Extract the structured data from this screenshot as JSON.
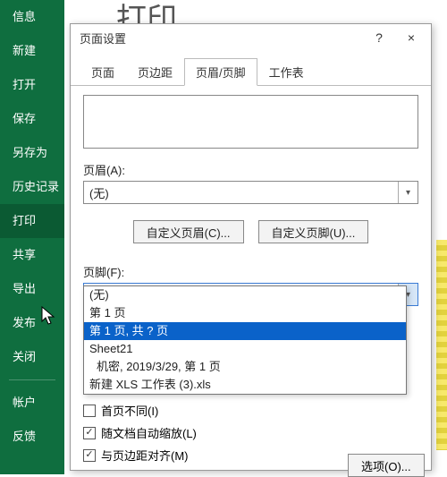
{
  "title": "打印",
  "sidebar": {
    "items": [
      "信息",
      "新建",
      "打开",
      "保存",
      "另存为",
      "历史记录",
      "打印",
      "共享",
      "导出",
      "发布",
      "关闭"
    ],
    "footer": [
      "帐户",
      "反馈"
    ],
    "active_index": 6
  },
  "dialog": {
    "title": "页面设置",
    "help": "?",
    "close": "×",
    "tabs": [
      "页面",
      "页边距",
      "页眉/页脚",
      "工作表"
    ],
    "active_tab": 2,
    "header_label": "页眉(A):",
    "header_value": "(无)",
    "custom_header_btn": "自定义页眉(C)...",
    "custom_footer_btn": "自定义页脚(U)...",
    "footer_label": "页脚(F):",
    "footer_value": "(无)",
    "footer_options": [
      "(无)",
      "第 1 页",
      "第 1 页, 共 ? 页",
      "Sheet21",
      "机密, 2019/3/29, 第 1 页",
      "新建 XLS 工作表 (3).xls"
    ],
    "footer_selected_index": 2,
    "checks": [
      {
        "label": "首页不同(I)",
        "checked": false
      },
      {
        "label": "随文档自动缩放(L)",
        "checked": true
      },
      {
        "label": "与页边距对齐(M)",
        "checked": true
      }
    ],
    "options_btn": "选项(O)..."
  }
}
